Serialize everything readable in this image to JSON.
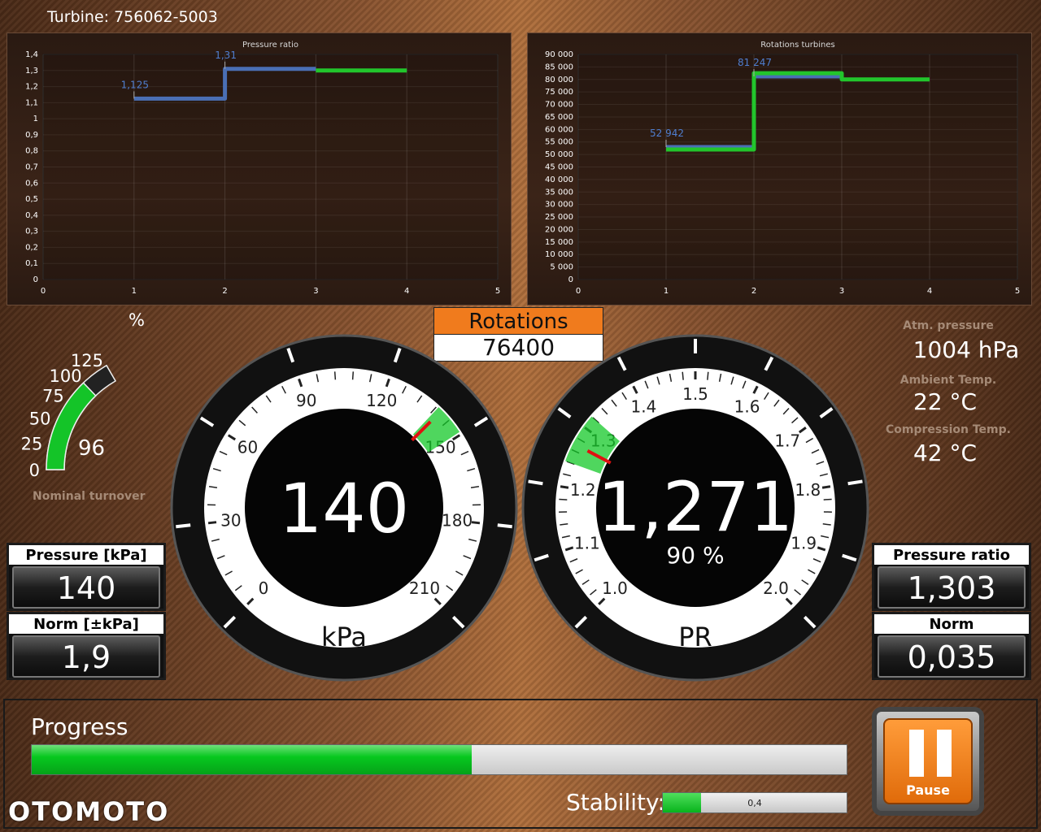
{
  "header": {
    "turbine_label": "Turbine: 756062-5003"
  },
  "charts": {
    "pressure": {
      "title": "Pressure ratio",
      "ylabels": [
        "1,4",
        "1,3",
        "1,2",
        "1,1",
        "1",
        "0,9",
        "0,8",
        "0,7",
        "0,6",
        "0,5",
        "0,4",
        "0,3",
        "0,2",
        "0,1",
        "0"
      ],
      "xlabels": [
        "0",
        "1",
        "2",
        "3",
        "4",
        "5"
      ],
      "point_labels": [
        "1,125",
        "1,31"
      ]
    },
    "rotations": {
      "title": "Rotations turbines",
      "ylabels": [
        "90 000",
        "85 000",
        "80 000",
        "75 000",
        "70 000",
        "65 000",
        "60 000",
        "55 000",
        "50 000",
        "45 000",
        "40 000",
        "35 000",
        "30 000",
        "25 000",
        "20 000",
        "15 000",
        "10 000",
        "5 000",
        "0"
      ],
      "xlabels": [
        "0",
        "1",
        "2",
        "3",
        "4",
        "5"
      ],
      "point_labels": [
        "52 942",
        "81 247"
      ]
    }
  },
  "chart_data": [
    {
      "type": "line",
      "title": "Pressure ratio",
      "xlabel": "",
      "ylabel": "",
      "xlim": [
        0,
        5
      ],
      "ylim": [
        0,
        1.4
      ],
      "grid": true,
      "series": [
        {
          "color": "#4a6fb5",
          "x": [
            1,
            2,
            2,
            3
          ],
          "y": [
            1.125,
            1.125,
            1.31,
            1.31
          ]
        },
        {
          "color": "#22c52c",
          "x": [
            3,
            4
          ],
          "y": [
            1.3,
            1.3
          ]
        }
      ],
      "annotations": [
        "1,125",
        "1,31"
      ]
    },
    {
      "type": "line",
      "title": "Rotations turbines",
      "xlabel": "",
      "ylabel": "",
      "xlim": [
        0,
        5
      ],
      "ylim": [
        0,
        90000
      ],
      "grid": true,
      "series": [
        {
          "color": "#4a6fb5",
          "x": [
            1,
            2,
            2,
            3
          ],
          "y": [
            52942,
            52942,
            81247,
            81247
          ]
        },
        {
          "color": "#22c52c",
          "x": [
            1,
            2,
            2,
            3,
            3,
            4
          ],
          "y": [
            52000,
            52000,
            82500,
            82500,
            80000,
            80000
          ]
        }
      ],
      "annotations": [
        "52 942",
        "81 247"
      ]
    }
  ],
  "rotations": {
    "label": "Rotations",
    "value": "76400"
  },
  "turnover": {
    "unit": "%",
    "ticks": [
      "125",
      "100",
      "75",
      "50",
      "25",
      "0"
    ],
    "value": "96",
    "fill": 0.77,
    "caption": "Nominal turnover"
  },
  "gauge_kpa": {
    "value": "140",
    "unit": "kPa",
    "ticks": [
      "0",
      "30",
      "60",
      "90",
      "120",
      "150",
      "180",
      "210"
    ]
  },
  "gauge_pr": {
    "value": "1,271",
    "percent": "90 %",
    "unit": "PR",
    "ticks": [
      "1.0",
      "1.1",
      "1.2",
      "1.3",
      "1.4",
      "1.5",
      "1.6",
      "1.7",
      "1.8",
      "1.9",
      "2.0"
    ]
  },
  "info": {
    "atm_label": "Atm. pressure",
    "atm_value": "1004 hPa",
    "ambient_label": "Ambient Temp.",
    "ambient_value": "22 °C",
    "compression_label": "Compression Temp.",
    "compression_value": "42 °C"
  },
  "readouts": {
    "pressure_label": "Pressure [kPa]",
    "pressure_value": "140",
    "norm_kpa_label": "Norm [±kPa]",
    "norm_kpa_value": "1,9",
    "ratio_label": "Pressure ratio",
    "ratio_value": "1,303",
    "norm_label": "Norm",
    "norm_value": "0,035"
  },
  "progress": {
    "label": "Progress",
    "fraction": 0.54
  },
  "stability": {
    "label": "Stability:",
    "value_text": "0,4",
    "fraction": 0.21
  },
  "pause": {
    "label": "Pause"
  },
  "watermark": "OTOMOTO"
}
